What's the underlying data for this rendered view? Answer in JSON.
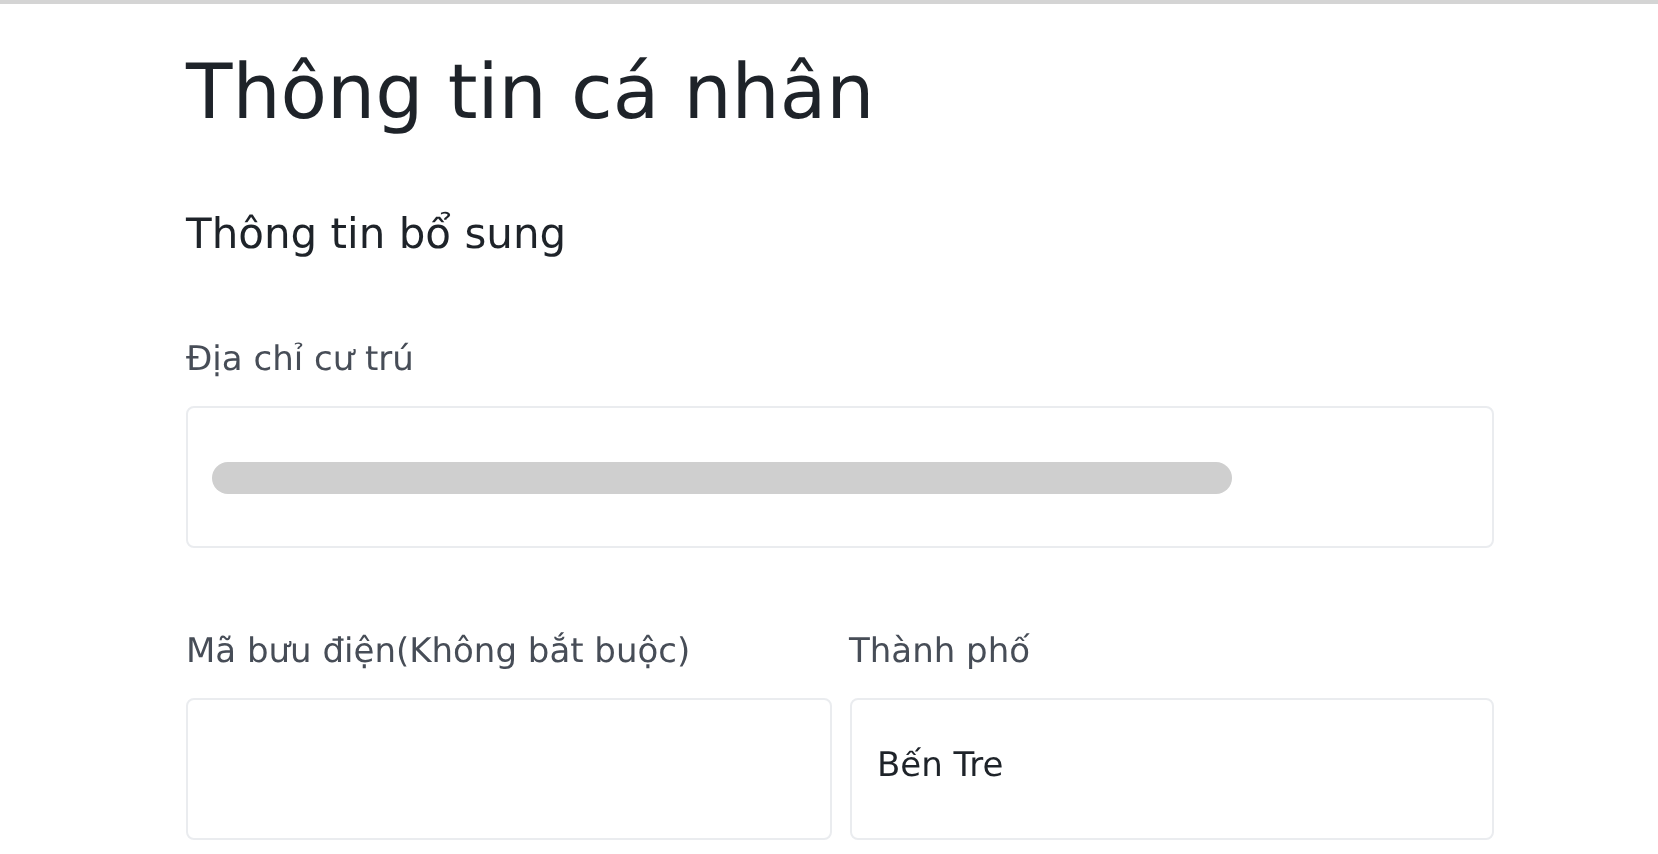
{
  "page_title": "Thông tin cá nhân",
  "section_title": "Thông tin bổ sung",
  "address": {
    "label": "Địa chỉ cư trú",
    "redacted": true
  },
  "postal_code": {
    "label": "Mã bưu điện(Không bắt buộc)"
  },
  "city": {
    "label": "Thành phố",
    "value": "Bến Tre"
  }
}
